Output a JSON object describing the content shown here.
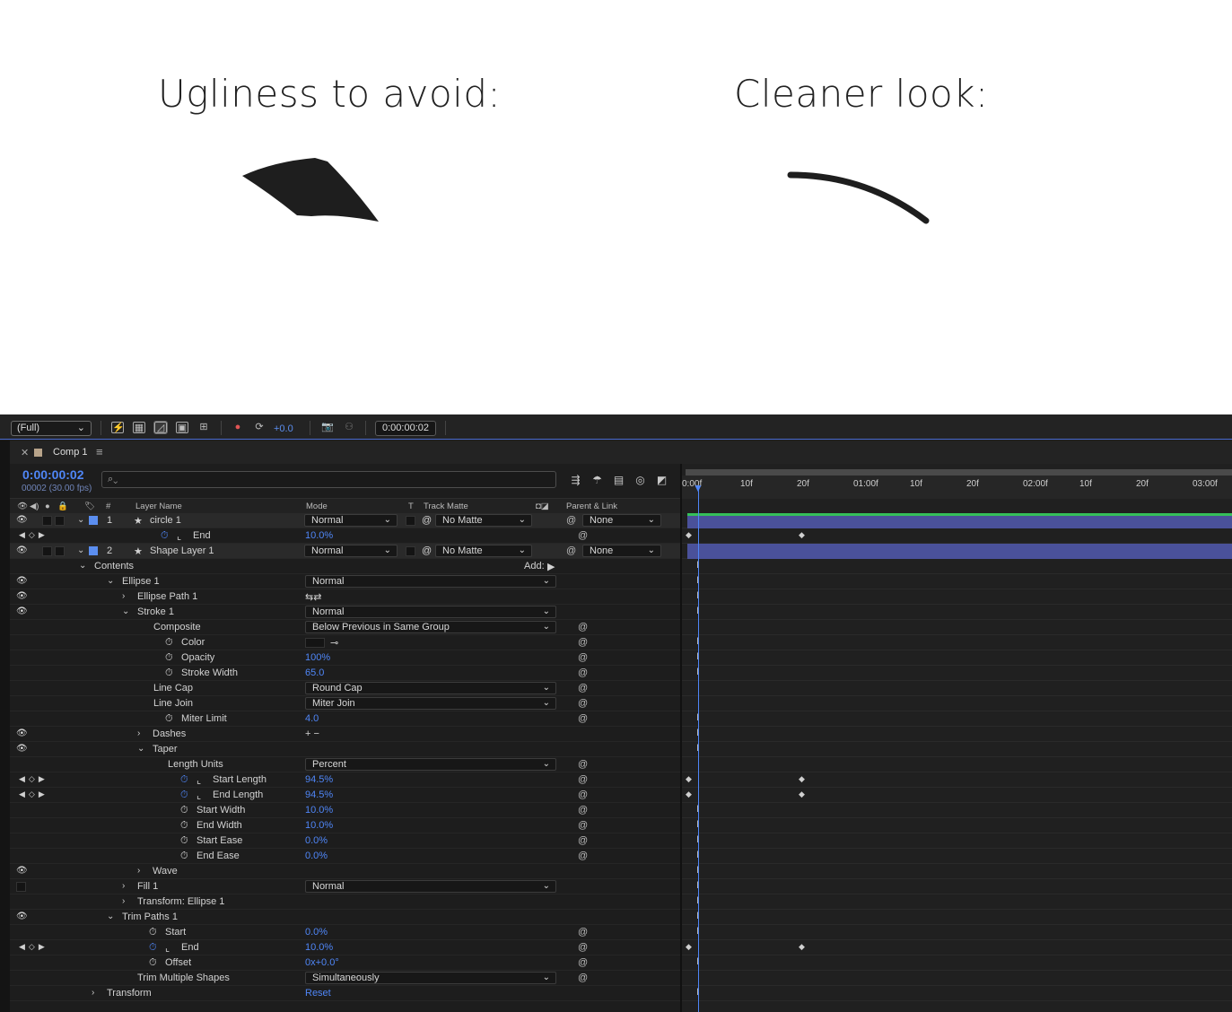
{
  "headings": {
    "left": "Ugliness to avoid:",
    "right": "Cleaner look:"
  },
  "toolbar": {
    "resolution": "(Full)",
    "exposure": "+0.0",
    "time": "0:00:00:02"
  },
  "panel": {
    "tab_title": "Comp 1",
    "timecode": "0:00:00:02",
    "frames": "00002 (30.00 fps)"
  },
  "columns": {
    "num": "#",
    "layer_name": "Layer Name",
    "mode": "Mode",
    "t": "T",
    "track_matte": "Track Matte",
    "parent": "Parent & Link"
  },
  "ruler": [
    "0:00f",
    "10f",
    "20f",
    "01:00f",
    "10f",
    "20f",
    "02:00f",
    "10f",
    "20f",
    "03:00f"
  ],
  "rows": [
    {
      "type": "layer",
      "num": "1",
      "name": "circle 1",
      "mode": "Normal",
      "matte": "No Matte",
      "parent": "None"
    },
    {
      "type": "prop",
      "name": "End",
      "value": "10.0%",
      "kf": true
    },
    {
      "type": "layer",
      "num": "2",
      "name": "Shape Layer 1",
      "mode": "Normal",
      "matte": "No Matte",
      "parent": "None"
    },
    {
      "type": "group",
      "name": "Contents",
      "add": "Add:"
    },
    {
      "type": "group",
      "name": "Ellipse 1",
      "dd": "Normal"
    },
    {
      "type": "group",
      "name": "Ellipse Path 1"
    },
    {
      "type": "group",
      "name": "Stroke 1",
      "dd": "Normal"
    },
    {
      "type": "prop",
      "name": "Composite",
      "dd": "Below Previous in Same Group"
    },
    {
      "type": "prop",
      "name": "Color"
    },
    {
      "type": "prop",
      "name": "Opacity",
      "value": "100%"
    },
    {
      "type": "prop",
      "name": "Stroke Width",
      "value": "65.0"
    },
    {
      "type": "prop",
      "name": "Line Cap",
      "dd": "Round Cap"
    },
    {
      "type": "prop",
      "name": "Line Join",
      "dd": "Miter Join"
    },
    {
      "type": "prop",
      "name": "Miter Limit",
      "value": "4.0"
    },
    {
      "type": "group",
      "name": "Dashes"
    },
    {
      "type": "group",
      "name": "Taper"
    },
    {
      "type": "prop",
      "name": "Length Units",
      "dd": "Percent"
    },
    {
      "type": "prop",
      "name": "Start Length",
      "value": "94.5%",
      "kf": true
    },
    {
      "type": "prop",
      "name": "End Length",
      "value": "94.5%",
      "kf": true
    },
    {
      "type": "prop",
      "name": "Start Width",
      "value": "10.0%"
    },
    {
      "type": "prop",
      "name": "End Width",
      "value": "10.0%"
    },
    {
      "type": "prop",
      "name": "Start Ease",
      "value": "0.0%"
    },
    {
      "type": "prop",
      "name": "End Ease",
      "value": "0.0%"
    },
    {
      "type": "group",
      "name": "Wave"
    },
    {
      "type": "group",
      "name": "Fill 1",
      "dd": "Normal"
    },
    {
      "type": "group",
      "name": "Transform: Ellipse 1"
    },
    {
      "type": "group",
      "name": "Trim Paths 1"
    },
    {
      "type": "prop",
      "name": "Start",
      "value": "0.0%"
    },
    {
      "type": "prop",
      "name": "End",
      "value": "10.0%",
      "kf": true
    },
    {
      "type": "prop",
      "name": "Offset",
      "value": "0x+0.0°"
    },
    {
      "type": "prop",
      "name": "Trim Multiple Shapes",
      "dd": "Simultaneously"
    },
    {
      "type": "group",
      "name": "Transform",
      "value": "Reset"
    }
  ],
  "colors": {
    "accent": "#4f86f7",
    "layer_bar": "#4a519a",
    "work_area_green": "#35c05a"
  }
}
